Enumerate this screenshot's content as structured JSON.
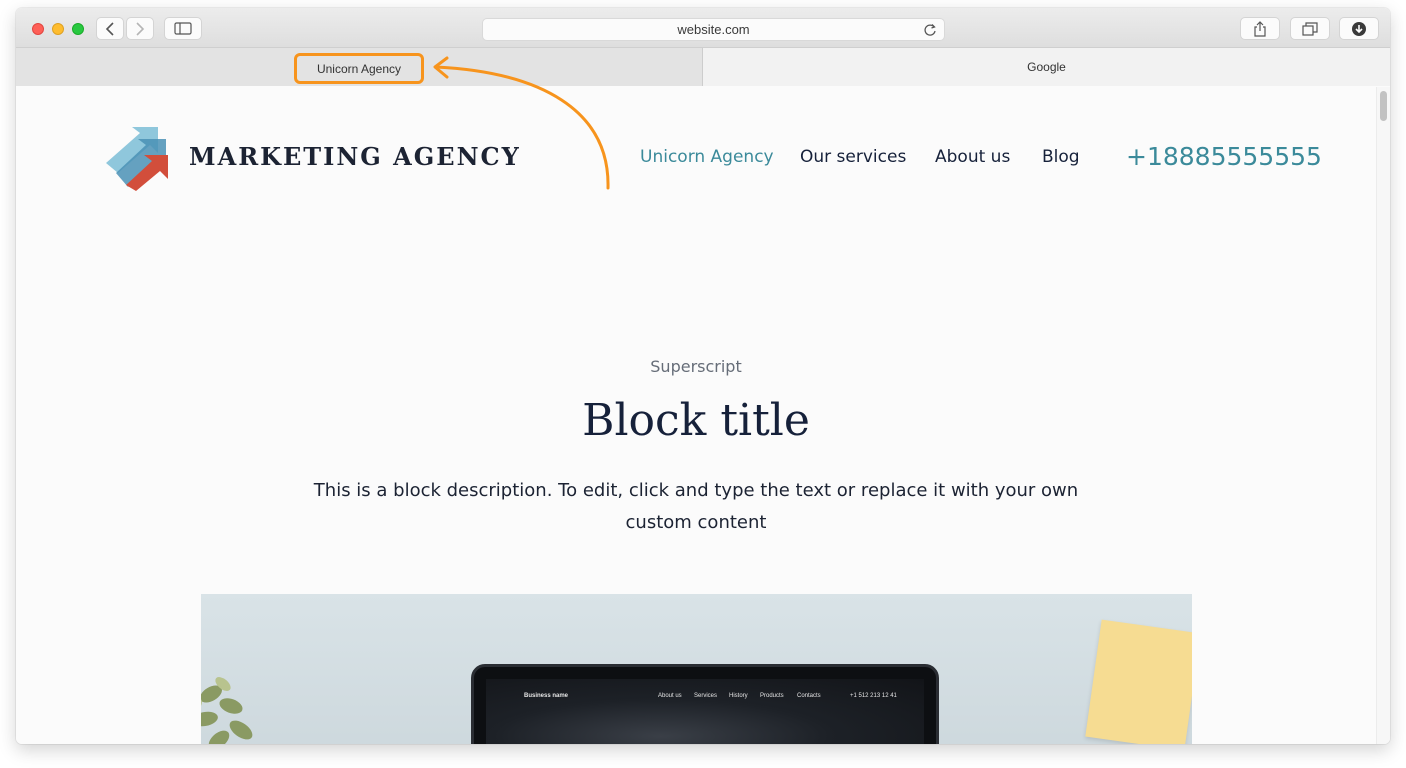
{
  "browser": {
    "url": "website.com",
    "tabs": [
      {
        "label": "Unicorn Agency",
        "active": true
      },
      {
        "label": "Google",
        "active": false
      }
    ],
    "highlight_color": "#f7941d"
  },
  "site": {
    "brand": "MARKETING AGENCY",
    "nav": [
      {
        "label": "Unicorn Agency",
        "active": true
      },
      {
        "label": "Our services",
        "active": false
      },
      {
        "label": "About us",
        "active": false
      },
      {
        "label": "Blog",
        "active": false
      }
    ],
    "phone": "+18885555555",
    "accent_color": "#3b8a9a",
    "logo_colors": [
      "#8fc7dc",
      "#4a91b5",
      "#d24e3b"
    ]
  },
  "block": {
    "superscript": "Superscript",
    "title": "Block title",
    "description": "This is a block description. To edit, click and type the text or replace it with your own custom content"
  },
  "hero_image": {
    "laptop_screen": {
      "brand": "Business name",
      "nav": [
        "About us",
        "Services",
        "History",
        "Products",
        "Contacts"
      ],
      "phone": "+1 512 213 12 41"
    }
  },
  "icons": [
    "back-icon",
    "forward-icon",
    "sidebar-icon",
    "reload-icon",
    "share-icon",
    "tabs-icon",
    "download-icon",
    "logo-arrows-icon"
  ]
}
